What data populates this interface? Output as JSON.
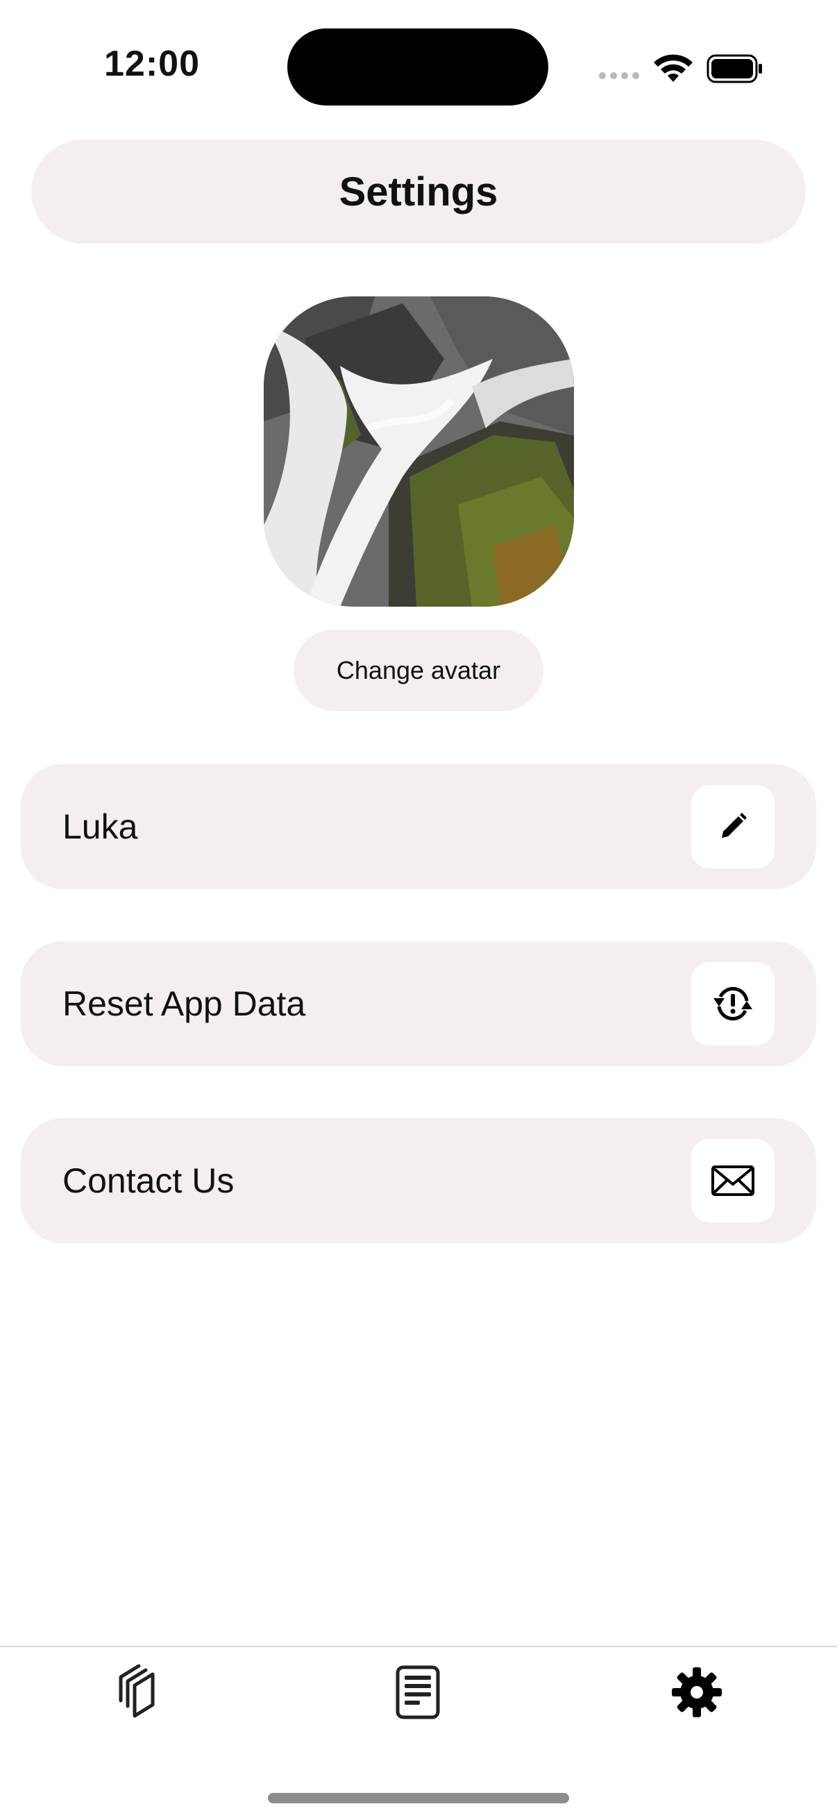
{
  "status_bar": {
    "time": "12:00"
  },
  "header": {
    "title": "Settings"
  },
  "profile": {
    "change_avatar_label": "Change avatar"
  },
  "settings": {
    "rows": [
      {
        "label": "Luka",
        "icon": "pencil-icon"
      },
      {
        "label": "Reset App Data",
        "icon": "reset-icon"
      },
      {
        "label": "Contact Us",
        "icon": "envelope-icon"
      }
    ]
  },
  "tab_bar": {
    "tabs": [
      {
        "icon": "library-icon"
      },
      {
        "icon": "document-icon"
      },
      {
        "icon": "gear-icon",
        "selected": true
      }
    ]
  },
  "colors": {
    "surface": "#f4efee",
    "background": "#ffffff",
    "text": "#111111"
  }
}
